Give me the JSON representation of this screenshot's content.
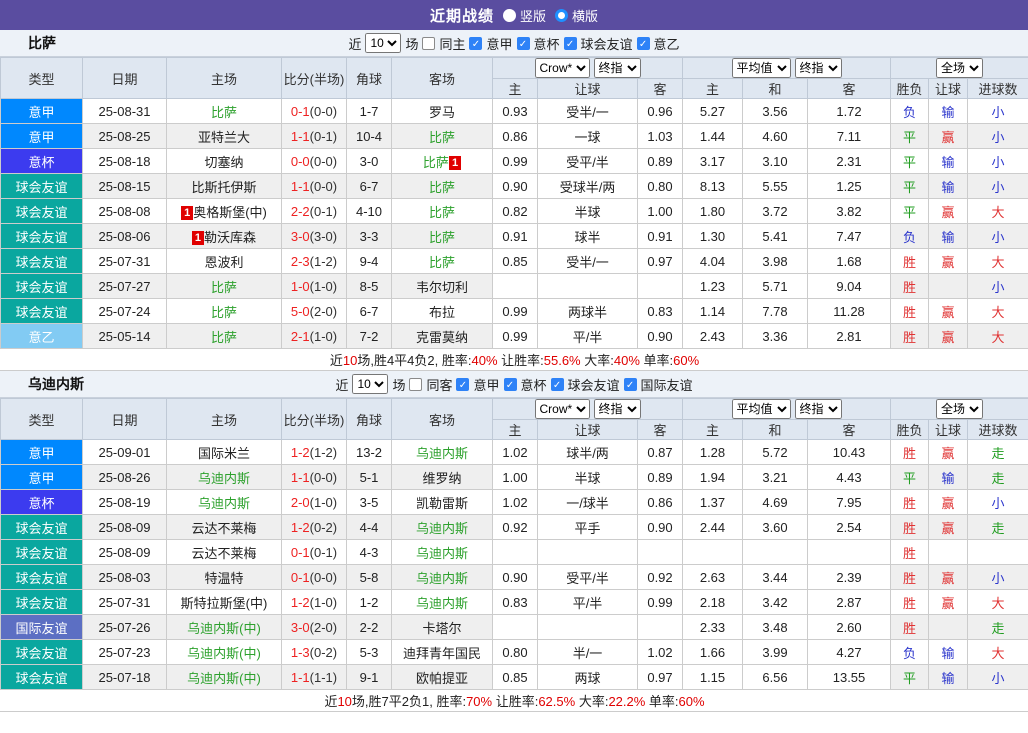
{
  "topbar": {
    "title": "近期战绩",
    "radios": [
      {
        "label": "竖版",
        "checked": false
      },
      {
        "label": "横版",
        "checked": true
      }
    ]
  },
  "colors": {
    "topbar": "#5a4da0",
    "accent_checkbox": "#2e82f7",
    "win_red": "#e03333",
    "lose_blue": "#2b35cc",
    "draw_green": "#1f9c1f",
    "team_green": "#2da12d",
    "score_red": "#ee2222"
  },
  "type_colors": {
    "意甲": "#0088fe",
    "意杯": "#3c3bef",
    "球会友谊": "#0aa79f",
    "意乙": "#82cbf3",
    "国际友谊": "#5c6fc3"
  },
  "sections": [
    {
      "team": "比萨",
      "filter": {
        "prefix": "近",
        "rounds": "10",
        "suffix": "场",
        "same_label": "同主",
        "same_checked": false,
        "leagues": [
          {
            "label": "意甲",
            "checked": true
          },
          {
            "label": "意杯",
            "checked": true
          },
          {
            "label": "球会友谊",
            "checked": true
          },
          {
            "label": "意乙",
            "checked": true
          }
        ]
      },
      "header": {
        "left_cols": [
          "类型",
          "日期",
          "主场",
          "比分(半场)",
          "角球",
          "客场"
        ],
        "selects": [
          "Crow*",
          "终指",
          "平均值",
          "终指",
          "全场"
        ],
        "sub_cols": [
          "主",
          "让球",
          "客",
          "主",
          "和",
          "客",
          "胜负",
          "让球",
          "进球数"
        ]
      },
      "rows": [
        {
          "type": "意甲",
          "date": "25-08-31",
          "home": {
            "name": "比萨",
            "green": true
          },
          "score": [
            "0-1",
            "(0-0)"
          ],
          "corner": "1-7",
          "away": {
            "name": "罗马"
          },
          "odds": [
            "0.93",
            "受半/一",
            "0.96"
          ],
          "avg": [
            "5.27",
            "3.56",
            "1.72"
          ],
          "results": [
            "负",
            "输",
            "小"
          ]
        },
        {
          "type": "意甲",
          "date": "25-08-25",
          "home": {
            "name": "亚特兰大"
          },
          "score": [
            "1-1",
            "(0-1)"
          ],
          "corner": "10-4",
          "away": {
            "name": "比萨",
            "green": true
          },
          "odds": [
            "0.86",
            "一球",
            "1.03"
          ],
          "avg": [
            "1.44",
            "4.60",
            "7.11"
          ],
          "results": [
            "平",
            "赢",
            "小"
          ]
        },
        {
          "type": "意杯",
          "date": "25-08-18",
          "home": {
            "name": "切塞纳"
          },
          "score": [
            "0-0",
            "(0-0)"
          ],
          "corner": "3-0",
          "away": {
            "name": "比萨",
            "green": true,
            "badge": "after"
          },
          "odds": [
            "0.99",
            "受平/半",
            "0.89"
          ],
          "avg": [
            "3.17",
            "3.10",
            "2.31"
          ],
          "results": [
            "平",
            "输",
            "小"
          ]
        },
        {
          "type": "球会友谊",
          "date": "25-08-15",
          "home": {
            "name": "比斯托伊斯"
          },
          "score": [
            "1-1",
            "(0-0)"
          ],
          "corner": "6-7",
          "away": {
            "name": "比萨",
            "green": true
          },
          "odds": [
            "0.90",
            "受球半/两",
            "0.80"
          ],
          "avg": [
            "8.13",
            "5.55",
            "1.25"
          ],
          "results": [
            "平",
            "输",
            "小"
          ]
        },
        {
          "type": "球会友谊",
          "date": "25-08-08",
          "home": {
            "name": "奥格斯堡(中)",
            "badge": "before"
          },
          "score": [
            "2-2",
            "(0-1)"
          ],
          "corner": "4-10",
          "away": {
            "name": "比萨",
            "green": true
          },
          "odds": [
            "0.82",
            "半球",
            "1.00"
          ],
          "avg": [
            "1.80",
            "3.72",
            "3.82"
          ],
          "results": [
            "平",
            "赢",
            "大"
          ]
        },
        {
          "type": "球会友谊",
          "date": "25-08-06",
          "home": {
            "name": "勒沃库森",
            "badge": "before"
          },
          "score": [
            "3-0",
            "(3-0)"
          ],
          "corner": "3-3",
          "away": {
            "name": "比萨",
            "green": true
          },
          "odds": [
            "0.91",
            "球半",
            "0.91"
          ],
          "avg": [
            "1.30",
            "5.41",
            "7.47"
          ],
          "results": [
            "负",
            "输",
            "小"
          ]
        },
        {
          "type": "球会友谊",
          "date": "25-07-31",
          "home": {
            "name": "恩波利"
          },
          "score": [
            "2-3",
            "(1-2)"
          ],
          "corner": "9-4",
          "away": {
            "name": "比萨",
            "green": true
          },
          "odds": [
            "0.85",
            "受半/一",
            "0.97"
          ],
          "avg": [
            "4.04",
            "3.98",
            "1.68"
          ],
          "results": [
            "胜",
            "赢",
            "大"
          ]
        },
        {
          "type": "球会友谊",
          "date": "25-07-27",
          "home": {
            "name": "比萨",
            "green": true
          },
          "score": [
            "1-0",
            "(1-0)"
          ],
          "corner": "8-5",
          "away": {
            "name": "韦尔切利"
          },
          "odds": [
            "",
            "",
            ""
          ],
          "avg": [
            "1.23",
            "5.71",
            "9.04"
          ],
          "results": [
            "胜",
            "",
            "小"
          ]
        },
        {
          "type": "球会友谊",
          "date": "25-07-24",
          "home": {
            "name": "比萨",
            "green": true
          },
          "score": [
            "5-0",
            "(2-0)"
          ],
          "corner": "6-7",
          "away": {
            "name": "布拉"
          },
          "odds": [
            "0.99",
            "两球半",
            "0.83"
          ],
          "avg": [
            "1.14",
            "7.78",
            "11.28"
          ],
          "results": [
            "胜",
            "赢",
            "大"
          ]
        },
        {
          "type": "意乙",
          "date": "25-05-14",
          "home": {
            "name": "比萨",
            "green": true
          },
          "score": [
            "2-1",
            "(1-0)"
          ],
          "corner": "7-2",
          "away": {
            "name": "克雷莫纳"
          },
          "odds": [
            "0.99",
            "平/半",
            "0.90"
          ],
          "avg": [
            "2.43",
            "3.36",
            "2.81"
          ],
          "results": [
            "胜",
            "赢",
            "大"
          ]
        }
      ],
      "summary": [
        {
          "t": "近"
        },
        {
          "t": "10",
          "r": true
        },
        {
          "t": "场,胜4平4负2, 胜率:"
        },
        {
          "t": "40%",
          "r": true
        },
        {
          "t": " 让胜率:"
        },
        {
          "t": "55.6%",
          "r": true
        },
        {
          "t": " 大率:"
        },
        {
          "t": "40%",
          "r": true
        },
        {
          "t": " 单率:"
        },
        {
          "t": "60%",
          "r": true
        }
      ]
    },
    {
      "team": "乌迪内斯",
      "filter": {
        "prefix": "近",
        "rounds": "10",
        "suffix": "场",
        "same_label": "同客",
        "same_checked": false,
        "leagues": [
          {
            "label": "意甲",
            "checked": true
          },
          {
            "label": "意杯",
            "checked": true
          },
          {
            "label": "球会友谊",
            "checked": true
          },
          {
            "label": "国际友谊",
            "checked": true
          }
        ]
      },
      "header": {
        "left_cols": [
          "类型",
          "日期",
          "主场",
          "比分(半场)",
          "角球",
          "客场"
        ],
        "selects": [
          "Crow*",
          "终指",
          "平均值",
          "终指",
          "全场"
        ],
        "sub_cols": [
          "主",
          "让球",
          "客",
          "主",
          "和",
          "客",
          "胜负",
          "让球",
          "进球数"
        ]
      },
      "rows": [
        {
          "type": "意甲",
          "date": "25-09-01",
          "home": {
            "name": "国际米兰"
          },
          "score": [
            "1-2",
            "(1-2)"
          ],
          "corner": "13-2",
          "away": {
            "name": "乌迪内斯",
            "green": true
          },
          "odds": [
            "1.02",
            "球半/两",
            "0.87"
          ],
          "avg": [
            "1.28",
            "5.72",
            "10.43"
          ],
          "results": [
            "胜",
            "赢",
            "走"
          ]
        },
        {
          "type": "意甲",
          "date": "25-08-26",
          "home": {
            "name": "乌迪内斯",
            "green": true
          },
          "score": [
            "1-1",
            "(0-0)"
          ],
          "corner": "5-1",
          "away": {
            "name": "维罗纳"
          },
          "odds": [
            "1.00",
            "半球",
            "0.89"
          ],
          "avg": [
            "1.94",
            "3.21",
            "4.43"
          ],
          "results": [
            "平",
            "输",
            "走"
          ]
        },
        {
          "type": "意杯",
          "date": "25-08-19",
          "home": {
            "name": "乌迪内斯",
            "green": true
          },
          "score": [
            "2-0",
            "(1-0)"
          ],
          "corner": "3-5",
          "away": {
            "name": "凯勒雷斯"
          },
          "odds": [
            "1.02",
            "一/球半",
            "0.86"
          ],
          "avg": [
            "1.37",
            "4.69",
            "7.95"
          ],
          "results": [
            "胜",
            "赢",
            "小"
          ]
        },
        {
          "type": "球会友谊",
          "date": "25-08-09",
          "home": {
            "name": "云达不莱梅"
          },
          "score": [
            "1-2",
            "(0-2)"
          ],
          "corner": "4-4",
          "away": {
            "name": "乌迪内斯",
            "green": true
          },
          "odds": [
            "0.92",
            "平手",
            "0.90"
          ],
          "avg": [
            "2.44",
            "3.60",
            "2.54"
          ],
          "results": [
            "胜",
            "赢",
            "走"
          ]
        },
        {
          "type": "球会友谊",
          "date": "25-08-09",
          "home": {
            "name": "云达不莱梅"
          },
          "score": [
            "0-1",
            "(0-1)"
          ],
          "corner": "4-3",
          "away": {
            "name": "乌迪内斯",
            "green": true
          },
          "odds": [
            "",
            "",
            ""
          ],
          "avg": [
            "",
            "",
            ""
          ],
          "results": [
            "胜",
            "",
            ""
          ]
        },
        {
          "type": "球会友谊",
          "date": "25-08-03",
          "home": {
            "name": "特温特"
          },
          "score": [
            "0-1",
            "(0-0)"
          ],
          "corner": "5-8",
          "away": {
            "name": "乌迪内斯",
            "green": true
          },
          "odds": [
            "0.90",
            "受平/半",
            "0.92"
          ],
          "avg": [
            "2.63",
            "3.44",
            "2.39"
          ],
          "results": [
            "胜",
            "赢",
            "小"
          ]
        },
        {
          "type": "球会友谊",
          "date": "25-07-31",
          "home": {
            "name": "斯特拉斯堡(中)"
          },
          "score": [
            "1-2",
            "(1-0)"
          ],
          "corner": "1-2",
          "away": {
            "name": "乌迪内斯",
            "green": true
          },
          "odds": [
            "0.83",
            "平/半",
            "0.99"
          ],
          "avg": [
            "2.18",
            "3.42",
            "2.87"
          ],
          "results": [
            "胜",
            "赢",
            "大"
          ]
        },
        {
          "type": "国际友谊",
          "date": "25-07-26",
          "home": {
            "name": "乌迪内斯(中)",
            "green": true
          },
          "score": [
            "3-0",
            "(2-0)"
          ],
          "corner": "2-2",
          "away": {
            "name": "卡塔尔"
          },
          "odds": [
            "",
            "",
            ""
          ],
          "avg": [
            "2.33",
            "3.48",
            "2.60"
          ],
          "results": [
            "胜",
            "",
            "走"
          ]
        },
        {
          "type": "球会友谊",
          "date": "25-07-23",
          "home": {
            "name": "乌迪内斯(中)",
            "green": true
          },
          "score": [
            "1-3",
            "(0-2)"
          ],
          "corner": "5-3",
          "away": {
            "name": "迪拜青年国民"
          },
          "odds": [
            "0.80",
            "半/一",
            "1.02"
          ],
          "avg": [
            "1.66",
            "3.99",
            "4.27"
          ],
          "results": [
            "负",
            "输",
            "大"
          ]
        },
        {
          "type": "球会友谊",
          "date": "25-07-18",
          "home": {
            "name": "乌迪内斯(中)",
            "green": true
          },
          "score": [
            "1-1",
            "(1-1)"
          ],
          "corner": "9-1",
          "away": {
            "name": "欧帕提亚"
          },
          "odds": [
            "0.85",
            "两球",
            "0.97"
          ],
          "avg": [
            "1.15",
            "6.56",
            "13.55"
          ],
          "results": [
            "平",
            "输",
            "小"
          ]
        }
      ],
      "summary": [
        {
          "t": "近"
        },
        {
          "t": "10",
          "r": true
        },
        {
          "t": "场,胜7平2负1, 胜率:"
        },
        {
          "t": "70%",
          "r": true
        },
        {
          "t": " 让胜率:"
        },
        {
          "t": "62.5%",
          "r": true
        },
        {
          "t": " 大率:"
        },
        {
          "t": "22.2%",
          "r": true
        },
        {
          "t": " 单率:"
        },
        {
          "t": "60%",
          "r": true
        }
      ]
    }
  ]
}
